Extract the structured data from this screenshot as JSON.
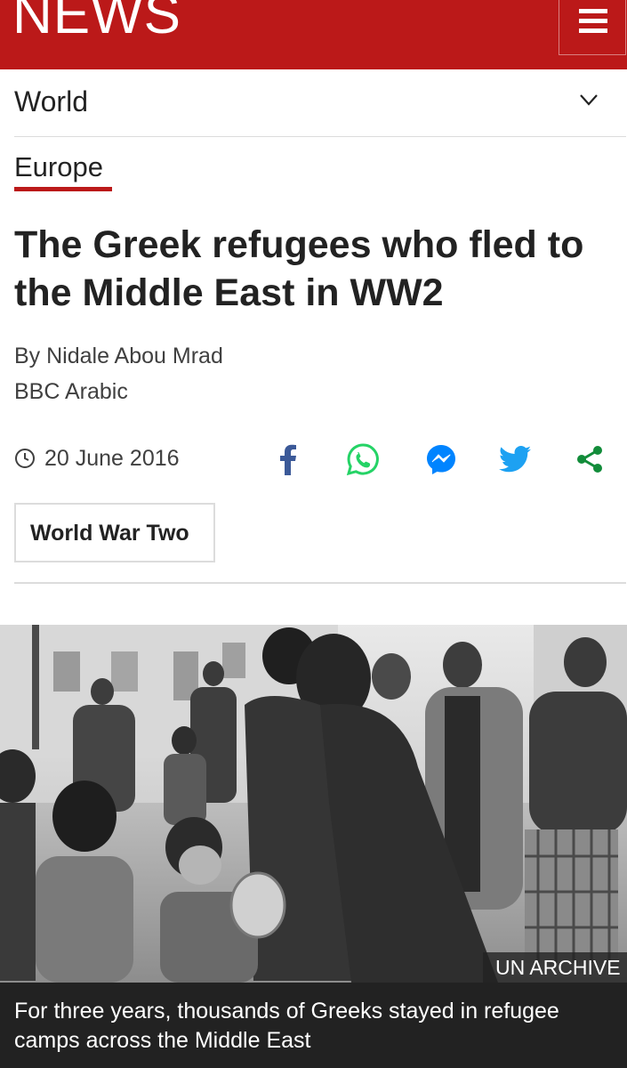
{
  "header": {
    "logo_text": "NEWS",
    "menu_icon": "hamburger-menu-icon",
    "brand_color": "#bb1919"
  },
  "section_nav": {
    "label": "World",
    "toggle_icon": "chevron-down-icon"
  },
  "article": {
    "category": "Europe",
    "headline": "The Greek refugees who fled to the Middle East in WW2",
    "byline": "By Nidale Abou Mrad",
    "organisation": "BBC Arabic",
    "date": "20 June 2016",
    "date_icon": "clock-icon",
    "tag": "World War Two"
  },
  "share": {
    "icons": [
      "facebook-icon",
      "whatsapp-icon",
      "messenger-icon",
      "twitter-icon",
      "share-icon"
    ],
    "colors": {
      "facebook": "#3b5998",
      "whatsapp": "#25d366",
      "messenger": "#0084ff",
      "twitter": "#1da1f2",
      "share": "#128c3a"
    }
  },
  "image": {
    "credit": "UN ARCHIVE",
    "caption": "For three years, thousands of Greeks stayed in refugee camps across the Middle East"
  }
}
